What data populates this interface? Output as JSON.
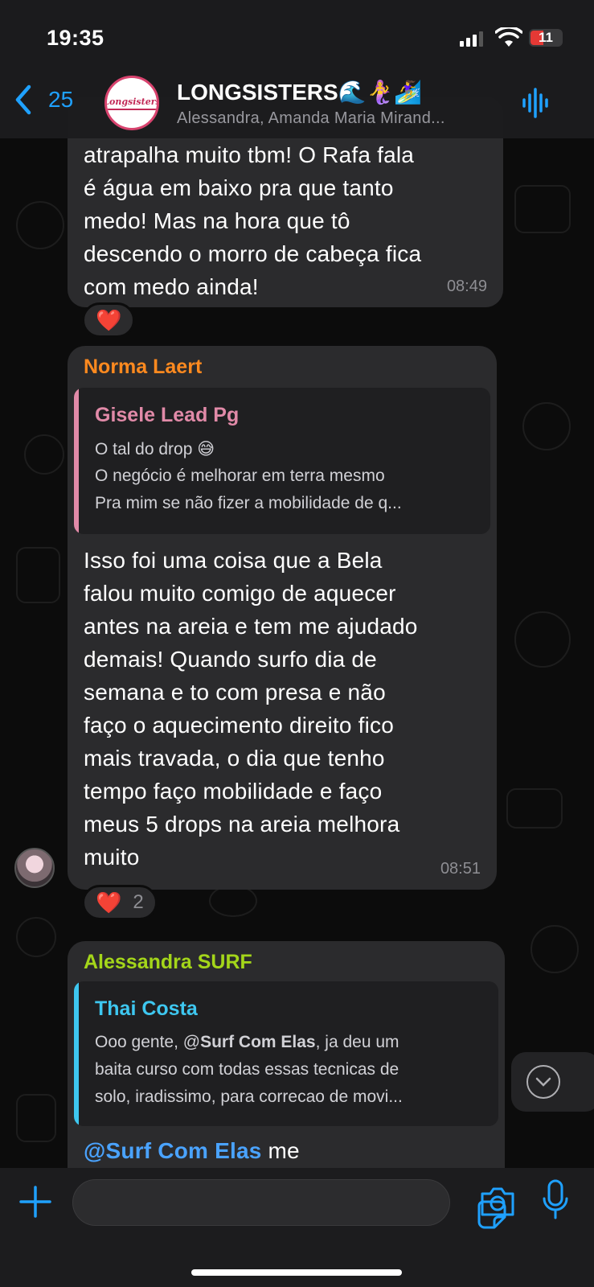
{
  "status_bar": {
    "time": "19:35",
    "battery": "11"
  },
  "header": {
    "back_count": "25",
    "avatar_logo": "Longsisters",
    "title": "LONGSISTERS🌊🧜‍♀️🏄‍♀️",
    "subtitle": "Alessandra, Amanda Maria Mirand..."
  },
  "messages": [
    {
      "lines": [
        "atrapalha muito tbm! O Rafa fala",
        "é água em baixo pra que tanto",
        "medo! Mas na hora que tô",
        "descendo o morro de cabeça fica",
        "com medo ainda!"
      ],
      "time": "08:49",
      "reaction": "❤️"
    },
    {
      "sender": "Norma Laert",
      "sender_color": "#ff8a1f",
      "quote": {
        "name": "Gisele Lead Pg",
        "name_color": "#e18aa8",
        "bar_color": "#e18aa8",
        "lines": [
          "O tal do drop 😅",
          "O negócio é melhorar em terra mesmo",
          "Pra mim se não fizer a mobilidade de q..."
        ]
      },
      "lines": [
        "Isso foi uma coisa que a Bela",
        "falou muito comigo de aquecer",
        "antes na areia e tem me ajudado",
        "demais! Quando surfo dia de",
        "semana e to com presa e não",
        "faço o aquecimento direito fico",
        "mais travada, o dia que tenho",
        "tempo faço mobilidade e faço",
        "meus 5 drops na areia melhora",
        "muito"
      ],
      "time": "08:51",
      "reaction": "❤️",
      "reaction_count": "2"
    },
    {
      "sender": "Alessandra SURF",
      "sender_color": "#a4d61a",
      "quote": {
        "name": "Thai Costa",
        "name_color": "#3ec7f0",
        "bar_color": "#3ec7f0",
        "line1_pre": "Ooo gente, @",
        "line1_mention": "Surf Com Elas",
        "line1_post": ", ja deu um",
        "lines": [
          "baita curso com todas essas tecnicas de",
          "solo, iradissimo, para correcao de movi..."
        ]
      },
      "mention_prefix": "@",
      "mention": "Surf Com Elas",
      "after_mention": " me"
    }
  ],
  "colors": {
    "accent": "#1fa1ff",
    "bubble": "#2b2b2d",
    "background": "#0c0c0c"
  }
}
